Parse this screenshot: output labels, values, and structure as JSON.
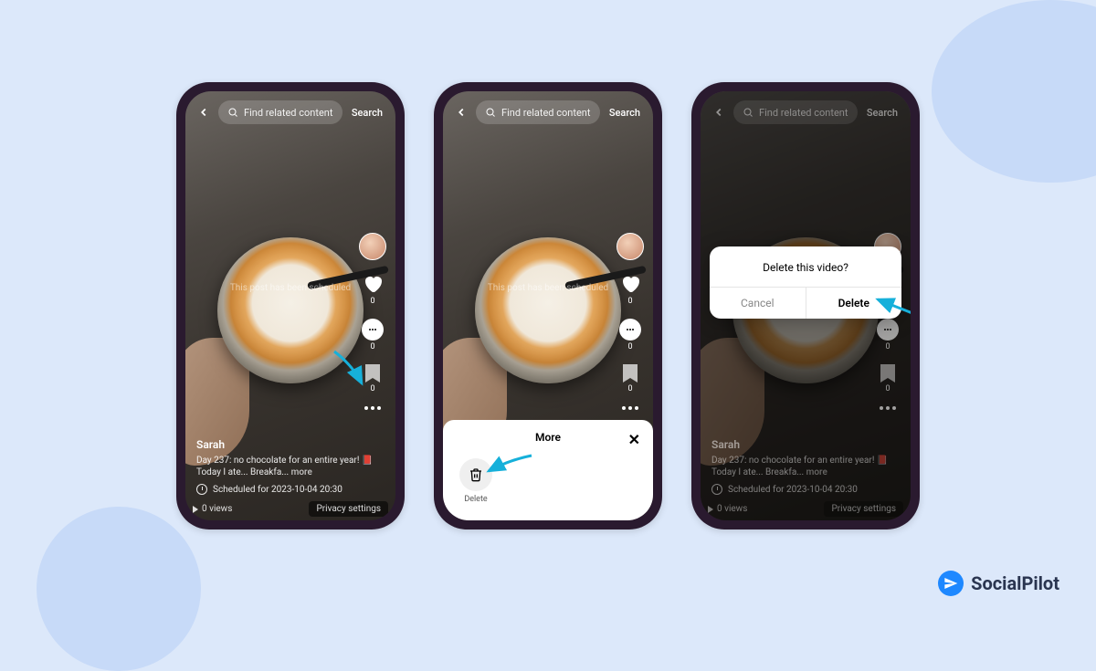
{
  "search": {
    "placeholder": "Find related content",
    "button": "Search"
  },
  "watermark": "This post has been scheduled",
  "counts": {
    "likes": "0",
    "comments": "0",
    "bookmarks": "0"
  },
  "caption": {
    "username": "Sarah",
    "text": "Day 237: no chocolate for an entire year! 📕 Today I ate... Breakfa...",
    "more": "more",
    "scheduled": "Scheduled for 2023-10-04 20:30"
  },
  "bottom": {
    "views": "0 views",
    "privacy": "Privacy settings"
  },
  "sheet": {
    "title": "More",
    "delete": "Delete"
  },
  "dialog": {
    "title": "Delete this video?",
    "cancel": "Cancel",
    "delete": "Delete"
  },
  "brand": "SocialPilot"
}
